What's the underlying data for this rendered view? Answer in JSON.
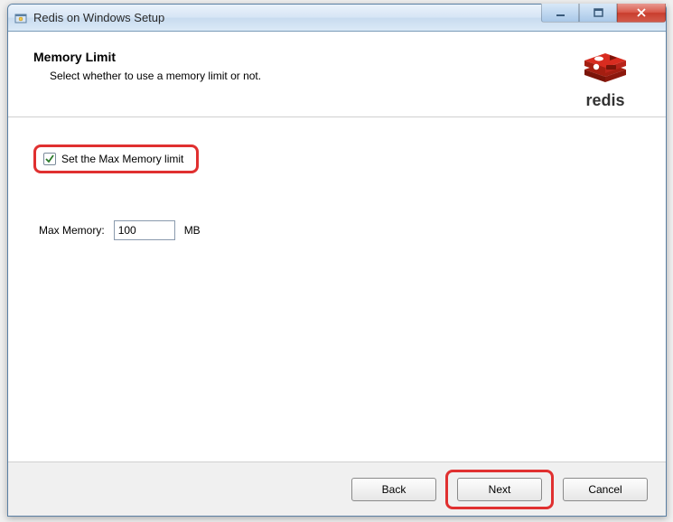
{
  "window": {
    "title": "Redis on Windows Setup"
  },
  "header": {
    "title": "Memory Limit",
    "subtitle": "Select whether to use a memory limit or not.",
    "logo_text": "redis"
  },
  "form": {
    "checkbox_label": "Set the Max Memory limit",
    "checkbox_checked": true,
    "memory_label": "Max Memory:",
    "memory_value": "100",
    "memory_unit": "MB"
  },
  "footer": {
    "back_label": "Back",
    "next_label": "Next",
    "cancel_label": "Cancel"
  }
}
